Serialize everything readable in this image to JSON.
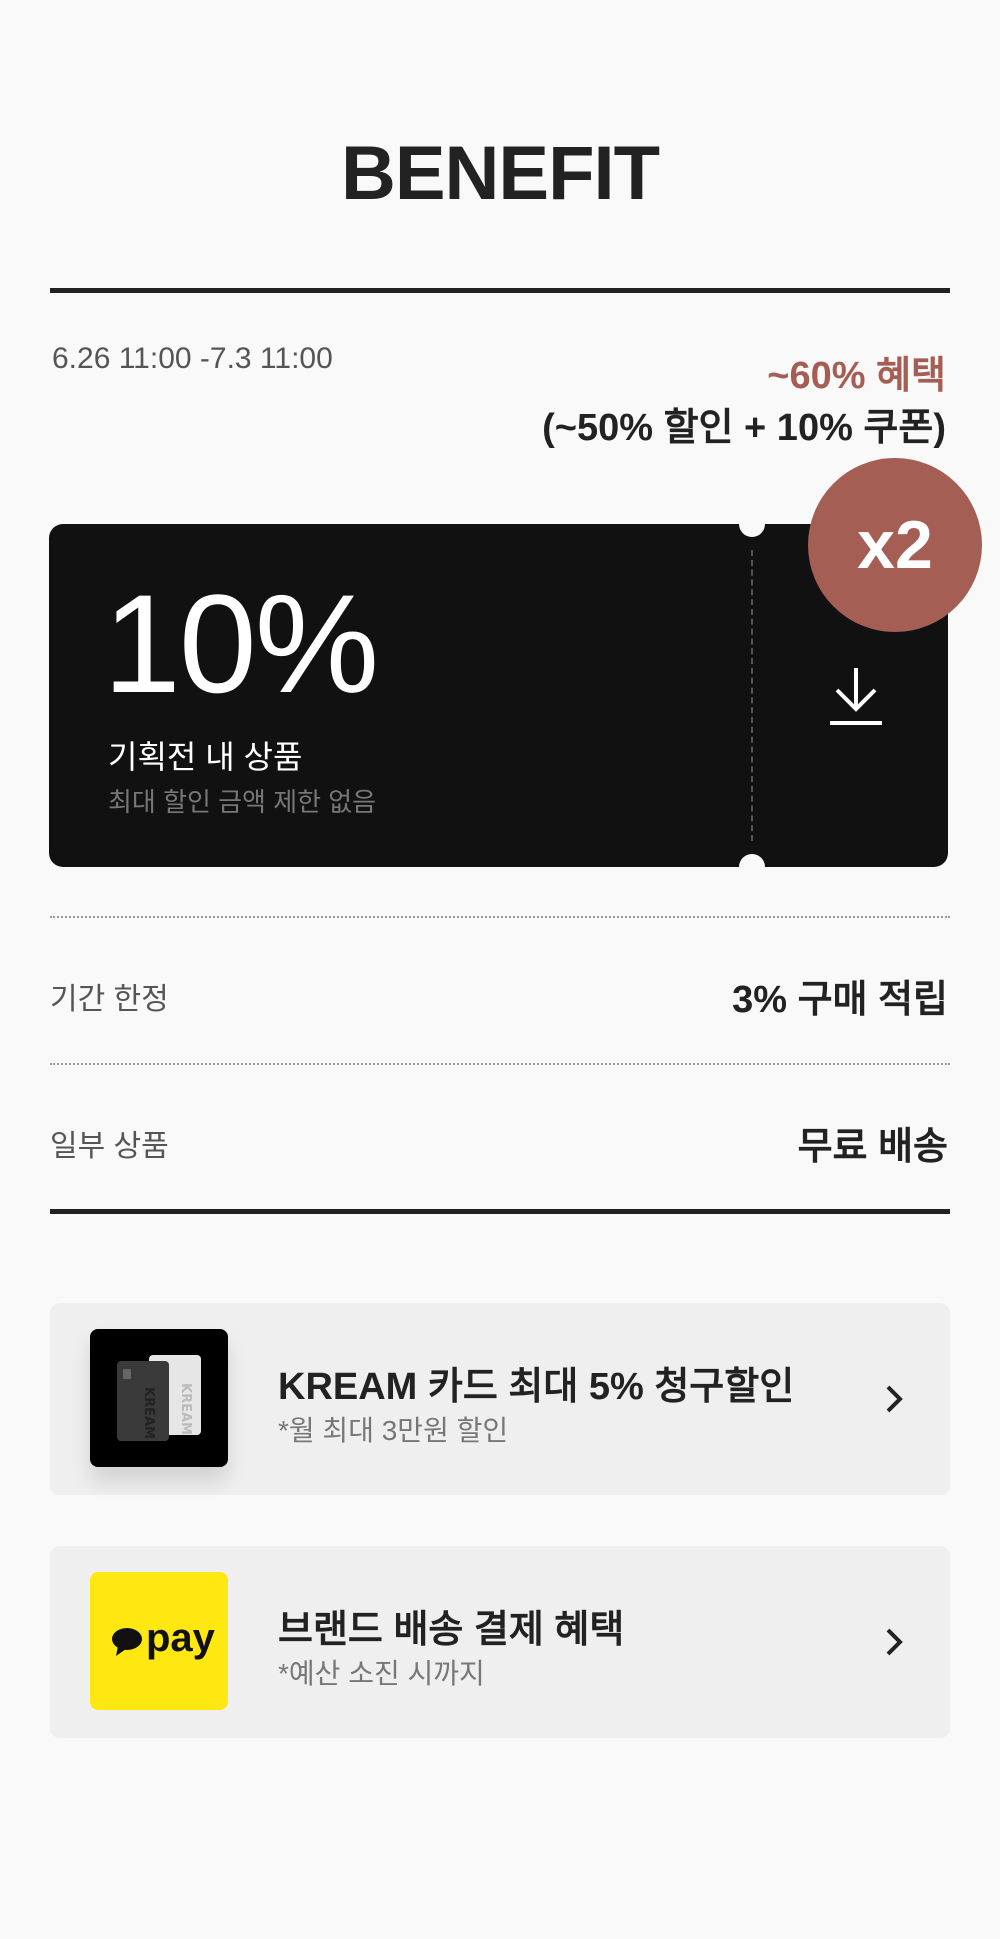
{
  "header": {
    "title": "BENEFIT"
  },
  "event": {
    "period": "6.26 11:00 -7.3 11:00",
    "benefit_highlight": "~60% 혜택",
    "benefit_detail": "(~50% 할인 + 10% 쿠폰)"
  },
  "coupon": {
    "percent": "10%",
    "label": "기획전 내 상품",
    "note": "최대 할인 금액 제한 없음",
    "badge": "x2",
    "download_icon": "download-icon"
  },
  "perks": [
    {
      "label": "기간 한정",
      "value": "3% 구매 적립"
    },
    {
      "label": "일부 상품",
      "value": "무료 배송"
    }
  ],
  "promos": [
    {
      "title": "KREAM 카드 최대 5% 청구할인",
      "sub": "*월 최대 3만원 할인",
      "thumb_icon": "kream-card-icon"
    },
    {
      "title": "브랜드 배송 결제 혜택",
      "sub": "*예산 소진 시까지",
      "thumb_icon": "kakao-pay-icon",
      "logo_text": "pay"
    }
  ],
  "colors": {
    "accent": "#a45e54",
    "ticket_bg": "#111111",
    "kakao_yellow": "#ffe812"
  }
}
